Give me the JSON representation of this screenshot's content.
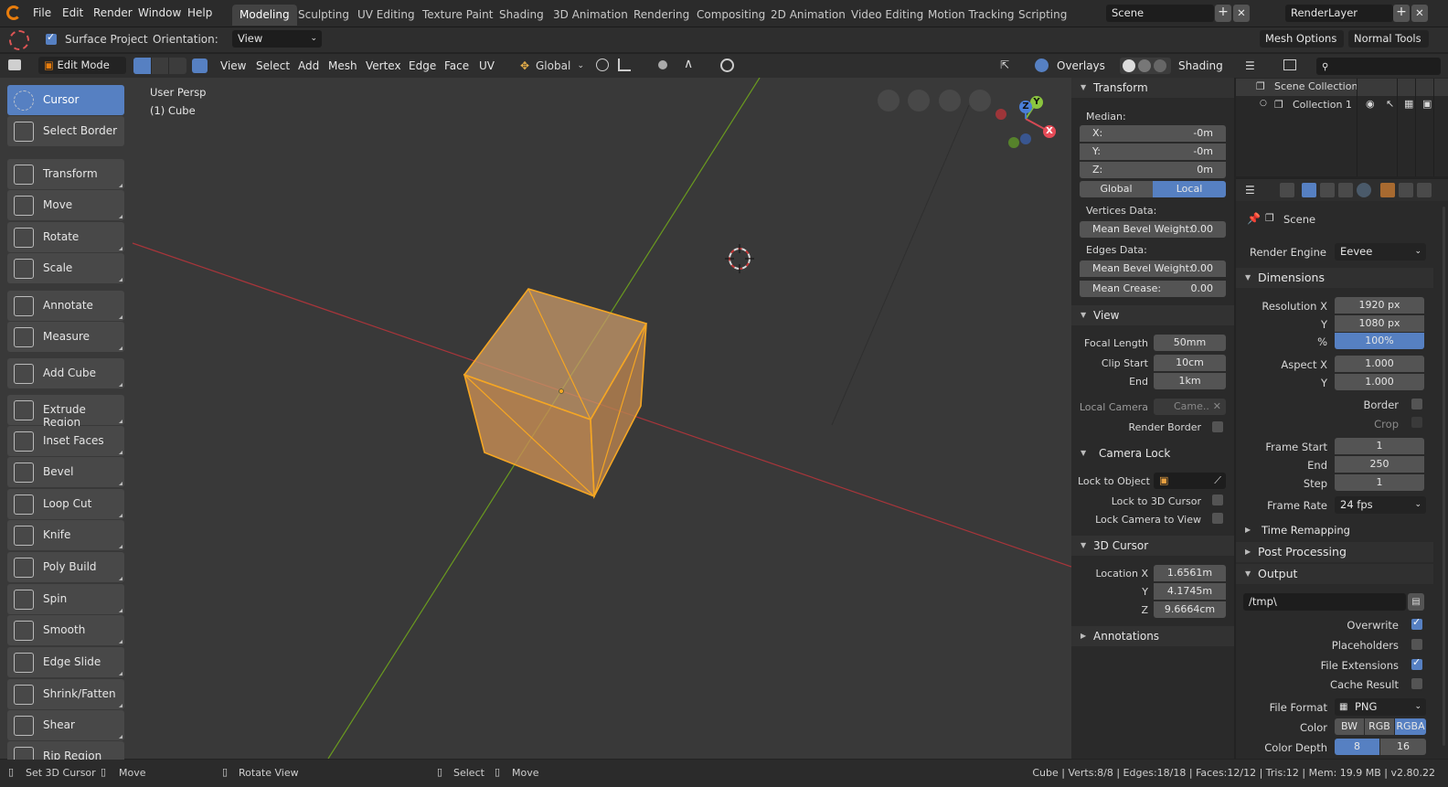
{
  "topbar": {
    "menus": [
      "File",
      "Edit",
      "Render",
      "Window",
      "Help"
    ],
    "workspaces": [
      "Modeling",
      "Sculpting",
      "UV Editing",
      "Texture Paint",
      "Shading",
      "3D Animation",
      "Rendering",
      "Compositing",
      "2D Animation",
      "Video Editing",
      "Motion Tracking",
      "Scripting"
    ],
    "active_workspace": "Modeling",
    "scene": "Scene",
    "view_layer": "RenderLayer"
  },
  "toolsettings": {
    "surface_project": "Surface Project",
    "orientation_label": "Orientation:",
    "orientation_value": "View",
    "mesh_options": "Mesh Options",
    "normal_tools": "Normal Tools"
  },
  "vpheader": {
    "mode": "Edit Mode",
    "menus": [
      "View",
      "Select",
      "Add",
      "Mesh",
      "Vertex",
      "Edge",
      "Face",
      "UV"
    ],
    "transform_orientation": "Global",
    "overlays": "Overlays",
    "shading": "Shading"
  },
  "viewport": {
    "view_name": "User Persp",
    "object_name": "(1) Cube",
    "axis_x": "X",
    "axis_y": "Y",
    "axis_z": "Z"
  },
  "tools": [
    {
      "label": "Cursor",
      "icon": "cursor-icon",
      "active": true
    },
    {
      "label": "Select Border",
      "icon": "select-border-icon"
    },
    {
      "label": "Transform",
      "icon": "transform-icon"
    },
    {
      "label": "Move",
      "icon": "move-icon"
    },
    {
      "label": "Rotate",
      "icon": "rotate-icon"
    },
    {
      "label": "Scale",
      "icon": "scale-icon"
    },
    {
      "label": "Annotate",
      "icon": "annotate-icon"
    },
    {
      "label": "Measure",
      "icon": "measure-icon"
    },
    {
      "label": "Add Cube",
      "icon": "add-cube-icon"
    },
    {
      "label": "Extrude Region",
      "icon": "extrude-region-icon"
    },
    {
      "label": "Inset Faces",
      "icon": "inset-faces-icon"
    },
    {
      "label": "Bevel",
      "icon": "bevel-icon"
    },
    {
      "label": "Loop Cut",
      "icon": "loop-cut-icon"
    },
    {
      "label": "Knife",
      "icon": "knife-icon"
    },
    {
      "label": "Poly Build",
      "icon": "poly-build-icon"
    },
    {
      "label": "Spin",
      "icon": "spin-icon"
    },
    {
      "label": "Smooth",
      "icon": "smooth-icon"
    },
    {
      "label": "Edge Slide",
      "icon": "edge-slide-icon"
    },
    {
      "label": "Shrink/Fatten",
      "icon": "shrink-fatten-icon"
    },
    {
      "label": "Shear",
      "icon": "shear-icon"
    },
    {
      "label": "Rip Region",
      "icon": "rip-region-icon"
    }
  ],
  "npanel": {
    "transform": {
      "title": "Transform",
      "median": "Median:",
      "x_label": "X:",
      "x": "-0m",
      "y_label": "Y:",
      "y": "-0m",
      "z_label": "Z:",
      "z": "0m",
      "global": "Global",
      "local": "Local",
      "vertices_data": "Vertices Data:",
      "edges_data": "Edges Data:",
      "mean_bevel_weight_label": "Mean Bevel Weight:",
      "vert_bevel": "0.00",
      "edge_bevel": "0.00",
      "mean_crease_label": "Mean Crease:",
      "crease": "0.00"
    },
    "view": {
      "title": "View",
      "focal_length_label": "Focal Length",
      "focal_length": "50mm",
      "clip_start_label": "Clip Start",
      "clip_start": "10cm",
      "end_label": "End",
      "clip_end": "1km",
      "local_camera_label": "Local Camera",
      "local_camera": "Came..",
      "render_border": "Render Border"
    },
    "camera_lock": {
      "title": "Camera Lock",
      "lock_to_object": "Lock to Object",
      "lock_to_cursor": "Lock to 3D Cursor",
      "lock_camera_to_view": "Lock Camera to View"
    },
    "cursor": {
      "title": "3D Cursor",
      "loc_x_label": "Location X",
      "x": "1.6561m",
      "y_label": "Y",
      "y": "4.1745m",
      "z_label": "Z",
      "z": "9.6664cm"
    },
    "annotations": "Annotations"
  },
  "outliner": {
    "scene_collection": "Scene Collection",
    "collection": "Collection 1"
  },
  "props": {
    "scene": "Scene",
    "render_engine_label": "Render Engine",
    "render_engine": "Eevee",
    "dimensions": "Dimensions",
    "res_x_label": "Resolution X",
    "res_x": "1920 px",
    "res_y_label": "Y",
    "res_y": "1080 px",
    "res_pct_label": "%",
    "res_pct": "100%",
    "aspect_x_label": "Aspect X",
    "aspect_x": "1.000",
    "aspect_y_label": "Y",
    "aspect_y": "1.000",
    "border": "Border",
    "crop": "Crop",
    "frame_start_label": "Frame Start",
    "frame_start": "1",
    "end_label": "End",
    "frame_end": "250",
    "step_label": "Step",
    "frame_step": "1",
    "frame_rate_label": "Frame Rate",
    "frame_rate": "24 fps",
    "time_remapping": "Time Remapping",
    "post_processing": "Post Processing",
    "output": "Output",
    "output_path": "/tmp\\",
    "overwrite": "Overwrite",
    "placeholders": "Placeholders",
    "file_extensions": "File Extensions",
    "cache_result": "Cache Result",
    "file_format_label": "File Format",
    "file_format": "PNG",
    "color_label": "Color",
    "color_bw": "BW",
    "color_rgb": "RGB",
    "color_rgba": "RGBA",
    "color_depth_label": "Color Depth",
    "depth_8": "8",
    "depth_16": "16"
  },
  "statusbar": {
    "set_cursor": "Set 3D Cursor",
    "move1": "Move",
    "rotate_view": "Rotate View",
    "select": "Select",
    "move2": "Move",
    "stats": "Cube | Verts:8/8 | Edges:18/18 | Faces:12/12 | Tris:12 | Mem: 19.9 MB | v2.80.22"
  },
  "colors": {
    "accent": "#5680c2",
    "selection": "#f5a623",
    "x_axis": "#a8353a",
    "y_axis": "#6a9a1f"
  }
}
